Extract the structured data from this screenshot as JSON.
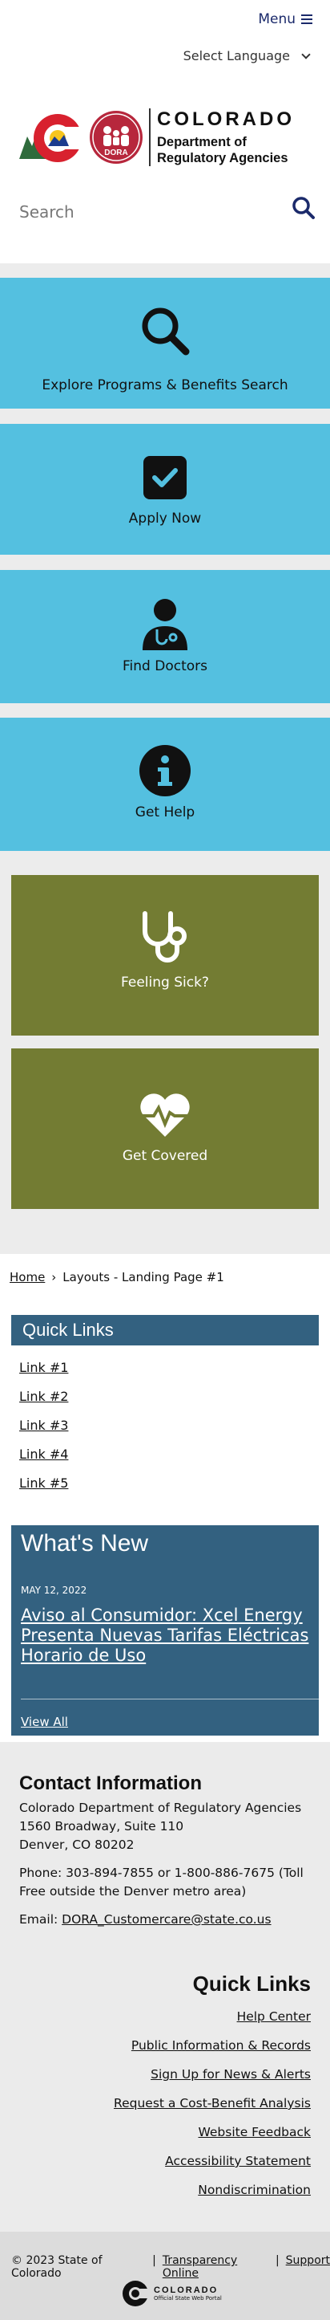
{
  "header": {
    "menu_label": "Menu",
    "language_label": "Select Language",
    "logo_wordmark": "COLORADO",
    "logo_dept_line1": "Department of",
    "logo_dept_line2": "Regulatory Agencies",
    "logo_dora": "DORA"
  },
  "search": {
    "placeholder": "Search"
  },
  "tiles": [
    {
      "label": "Explore Programs & Benefits Search",
      "icon": "search-icon"
    },
    {
      "label": "Apply Now",
      "icon": "checkbox-icon"
    },
    {
      "label": "Find Doctors",
      "icon": "doctor-icon"
    },
    {
      "label": "Get Help",
      "icon": "info-icon"
    }
  ],
  "feature_tiles": [
    {
      "label": "Feeling Sick?",
      "icon": "stethoscope-icon"
    },
    {
      "label": "Get Covered",
      "icon": "heart-pulse-icon"
    }
  ],
  "breadcrumb": {
    "home": "Home",
    "separator": "›",
    "current": "Layouts - Landing Page #1"
  },
  "quick_links": {
    "title": "Quick Links",
    "links": [
      "Link #1",
      "Link #2",
      "Link #3",
      "Link #4",
      "Link #5"
    ]
  },
  "whats_new": {
    "title": "What's New",
    "date": "MAY 12, 2022",
    "headline": "Aviso al Consumidor: Xcel Energy Presenta Nuevas Tarifas Eléctricas Horario de Uso",
    "view_all": "View All"
  },
  "contact": {
    "title": "Contact Information",
    "org": "Colorado Department of Regulatory Agencies",
    "address1": "1560 Broadway, Suite 110",
    "address2": "Denver, CO 80202",
    "phone": "Phone: 303-894-7855 or 1-800-886-7675 (Toll Free outside the Denver metro area)",
    "email_label": "Email: ",
    "email": "DORA_Customercare@state.co.us"
  },
  "footer_quick_links": {
    "title": "Quick Links",
    "links": [
      "Help Center",
      "Public Information & Records",
      "Sign Up for News & Alerts",
      "Request a Cost-Benefit Analysis",
      "Website Feedback",
      "Accessibility Statement",
      "Nondiscrimination"
    ]
  },
  "bottom": {
    "copyright": "© 2023 State of Colorado",
    "sep": "|",
    "transparency": "Transparency Online",
    "support": "Support",
    "brand_line1": "COLORADO",
    "brand_line2": "Official State Web Portal"
  },
  "colors": {
    "tile_blue": "#54c0e0",
    "tile_olive": "#737c33",
    "navy": "#336180",
    "menu_text": "#1b2a6b"
  }
}
